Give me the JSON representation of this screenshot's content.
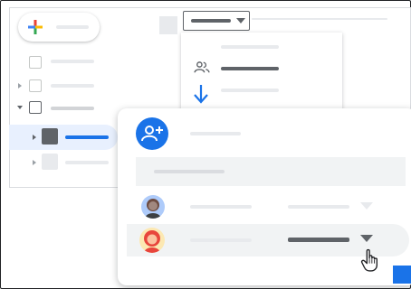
{
  "icons": {
    "new": "plus-icon",
    "check": "checkbox-icon",
    "drive": "drive-icon",
    "computer": "computer-icon",
    "folder": "folder-icon",
    "people": "people-icon",
    "arrow": "arrow-down-icon",
    "add_person": "add-person-icon",
    "cursor": "hand-cursor-icon"
  },
  "colors": {
    "accent": "#1a73e8",
    "text_dark": "#5f6368",
    "line_light": "#e8eaed",
    "surface": "#f1f3f4"
  }
}
